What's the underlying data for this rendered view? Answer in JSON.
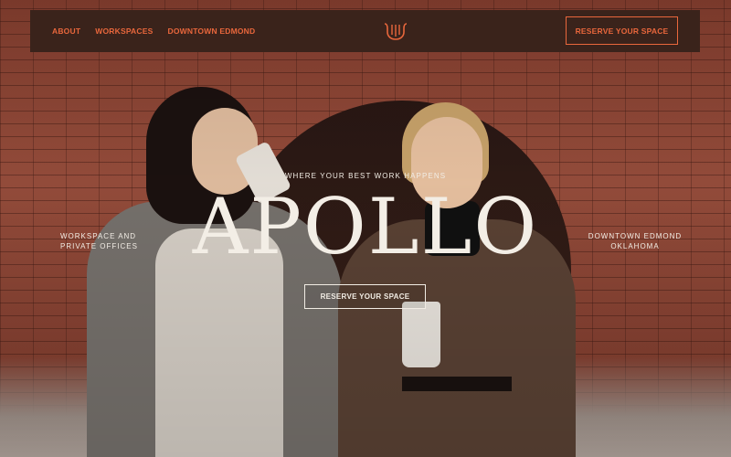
{
  "nav": {
    "links": [
      "ABOUT",
      "WORKSPACES",
      "DOWNTOWN EDMOND"
    ],
    "cta_label": "RESERVE YOUR SPACE",
    "logo_icon": "apollo-lyre-logo-icon"
  },
  "hero": {
    "tagline": "WHERE YOUR BEST WORK HAPPENS",
    "brand": "APOLLO",
    "left_line1": "WORKSPACE AND",
    "left_line2": "PRIVATE OFFICES",
    "right_line1": "DOWNTOWN EDMOND",
    "right_line2": "OKLAHOMA",
    "cta_label": "RESERVE YOUR SPACE",
    "image": "two-women-with-coffee-brick-wall-photo"
  },
  "colors": {
    "accent": "#e9673c",
    "nav_bg": "#3a231b",
    "text_light": "#f1ece4"
  }
}
